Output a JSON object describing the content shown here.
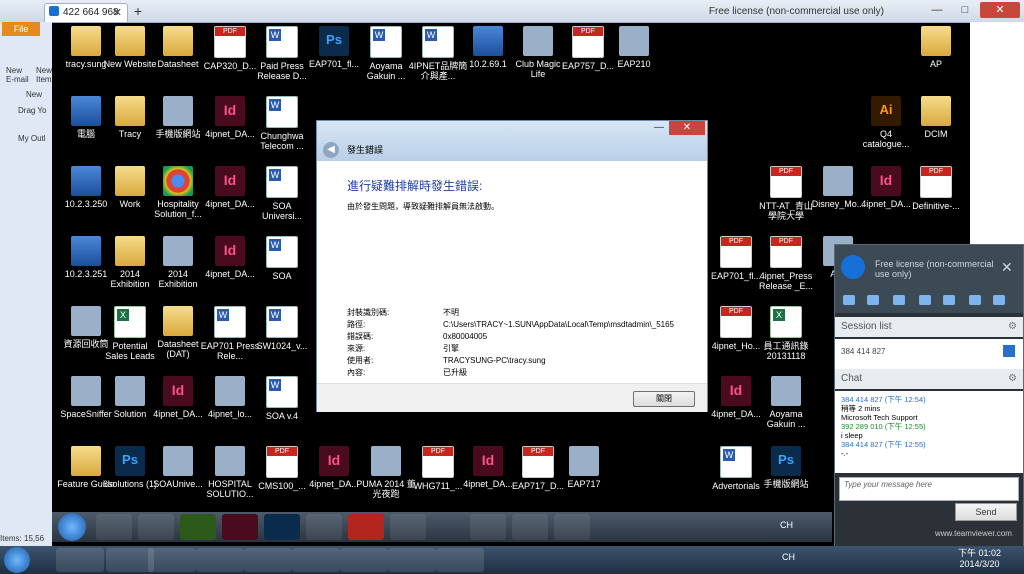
{
  "tv_window": {
    "tab_label": "422 664 968",
    "license": "Free license (non-commercial use only)",
    "min": "—",
    "max": "□",
    "close": "✕"
  },
  "outlook": {
    "file_tab": "File",
    "new_email": "New",
    "new_email2": "E-mail",
    "new_item": "New",
    "new_item2": "Item",
    "new_group": "New",
    "drag": "Drag Yo",
    "my_outlook": "My Outl",
    "items_status": "Items: 15,56"
  },
  "desktop_icons": [
    {
      "label": "tracy.sung",
      "type": "folder"
    },
    {
      "label": "New Website",
      "type": "folder"
    },
    {
      "label": "Datasheet",
      "type": "folder"
    },
    {
      "label": "CAP320_D...",
      "type": "pdf"
    },
    {
      "label": "Paid Press Release D...",
      "type": "word"
    },
    {
      "label": "EAP701_fl...",
      "type": "psd"
    },
    {
      "label": "Aoyama Gakuin ...",
      "type": "word"
    },
    {
      "label": "4IPNET品牌簡介與產...",
      "type": "word"
    },
    {
      "label": "10.2.69.1",
      "type": "comp"
    },
    {
      "label": "Club Magic Life",
      "type": "generic"
    },
    {
      "label": "EAP757_D...",
      "type": "pdf"
    },
    {
      "label": "EAP210",
      "type": "generic"
    },
    {
      "label": "AP",
      "type": "folder"
    },
    {
      "label": "電腦",
      "type": "comp"
    },
    {
      "label": "Tracy",
      "type": "folder"
    },
    {
      "label": "手機版網站",
      "type": "generic"
    },
    {
      "label": "4ipnet_DA...",
      "type": "indd"
    },
    {
      "label": "Chunghwa Telecom ...",
      "type": "word"
    },
    {
      "label": "Q4 catalogue...",
      "type": "ai"
    },
    {
      "label": "DCIM",
      "type": "folder"
    },
    {
      "label": "10.2.3.250",
      "type": "comp"
    },
    {
      "label": "Work",
      "type": "folder"
    },
    {
      "label": "Hospitality Solution_f...",
      "type": "chrome"
    },
    {
      "label": "4ipnet_DA...",
      "type": "indd"
    },
    {
      "label": "SOA Universi...",
      "type": "word"
    },
    {
      "label": "NTT-AT_青山學院大學",
      "type": "pdf"
    },
    {
      "label": "Disney_Mo...",
      "type": "generic"
    },
    {
      "label": "4ipnet_DA...",
      "type": "indd"
    },
    {
      "label": "Definitive-...",
      "type": "pdf"
    },
    {
      "label": "10.2.3.251",
      "type": "comp"
    },
    {
      "label": "2014 Exhibition",
      "type": "folder"
    },
    {
      "label": "2014 Exhibition",
      "type": "generic"
    },
    {
      "label": "4ipnet_DA...",
      "type": "indd"
    },
    {
      "label": "SOA",
      "type": "word"
    },
    {
      "label": "EAP701_fl...",
      "type": "pdf"
    },
    {
      "label": "4ipnet_Press Release _E...",
      "type": "pdf"
    },
    {
      "label": "Aoy",
      "type": "generic"
    },
    {
      "label": "資源回收筒",
      "type": "generic"
    },
    {
      "label": "Potential Sales Leads",
      "type": "excel"
    },
    {
      "label": "Datasheet (DAT)",
      "type": "folder"
    },
    {
      "label": "EAP701 Press Rele...",
      "type": "word"
    },
    {
      "label": "SW1024_v...",
      "type": "word"
    },
    {
      "label": "4ipnet_Ho...",
      "type": "pdf"
    },
    {
      "label": "員工通訊錄 20131118",
      "type": "excel"
    },
    {
      "label": "SpaceSniffer",
      "type": "generic"
    },
    {
      "label": "Solution",
      "type": "generic"
    },
    {
      "label": "4ipnet_DA...",
      "type": "indd"
    },
    {
      "label": "4ipnet_lo...",
      "type": "generic"
    },
    {
      "label": "SOA v.4",
      "type": "word"
    },
    {
      "label": "4ipnet_DA...",
      "type": "indd"
    },
    {
      "label": "Aoyama Gakuin ...",
      "type": "generic"
    },
    {
      "label": "Feature Guide",
      "type": "folder"
    },
    {
      "label": "6solutions (1)",
      "type": "psd"
    },
    {
      "label": "SOAUnive...",
      "type": "generic"
    },
    {
      "label": "HOSPITAL SOLUTIO...",
      "type": "generic"
    },
    {
      "label": "CMS100_...",
      "type": "pdf"
    },
    {
      "label": "4ipnet_DA...",
      "type": "indd"
    },
    {
      "label": "PUMA 2014 董光夜跑",
      "type": "generic"
    },
    {
      "label": "WHG711_...",
      "type": "pdf"
    },
    {
      "label": "4ipnet_DA...",
      "type": "indd"
    },
    {
      "label": "EAP717_D...",
      "type": "pdf"
    },
    {
      "label": "EAP717",
      "type": "generic"
    },
    {
      "label": "Advertorials",
      "type": "word"
    },
    {
      "label": "手機版網站",
      "type": "psd"
    }
  ],
  "dialog": {
    "caption": "發生錯誤",
    "heading": "進行疑難排解時發生錯誤:",
    "message": "由於發生問題，導致疑難排解員無法啟動。",
    "rows": [
      {
        "key": "封裝識別碼:",
        "value": "不明"
      },
      {
        "key": "路徑:",
        "value": "C:\\Users\\TRACY~1.SUN\\AppData\\Local\\Temp\\msdtadmin\\_5165"
      },
      {
        "key": "錯誤碼:",
        "value": "0x80004005"
      },
      {
        "key": "來源:",
        "value": "引擎"
      },
      {
        "key": "使用者:",
        "value": "TRACYSUNG-PC\\tracy.sung"
      },
      {
        "key": "內容:",
        "value": "已升級"
      }
    ],
    "close_button": "關閉"
  },
  "tv_panel": {
    "license": "Free license (non-commercial use only)",
    "session_list": "Session list",
    "session_id": "384 414 827",
    "chat": "Chat",
    "chat_lines": [
      {
        "text": "384 414 827 (下午 12:54)",
        "color": "#2a6fc9"
      },
      {
        "text": "稍等 2 mins",
        "color": "#000000"
      },
      {
        "text": "Microsoft Tech Support",
        "color": "#000000"
      },
      {
        "text": "392 289 010 (下午 12:55)",
        "color": "#1b8a2e"
      },
      {
        "text": "i sleep",
        "color": "#000000"
      },
      {
        "text": "384 414 827 (下午 12:55)",
        "color": "#2a6fc9"
      },
      {
        "text": "-.-",
        "color": "#000000"
      }
    ],
    "input_placeholder": "Type your message here",
    "send": "Send",
    "website": "www.teamviewer.com"
  },
  "remote_taskbar": {
    "ime": "CH"
  },
  "local_taskbar": {
    "ime": "CH",
    "time": "下午 01:02",
    "date": "2014/3/20"
  }
}
